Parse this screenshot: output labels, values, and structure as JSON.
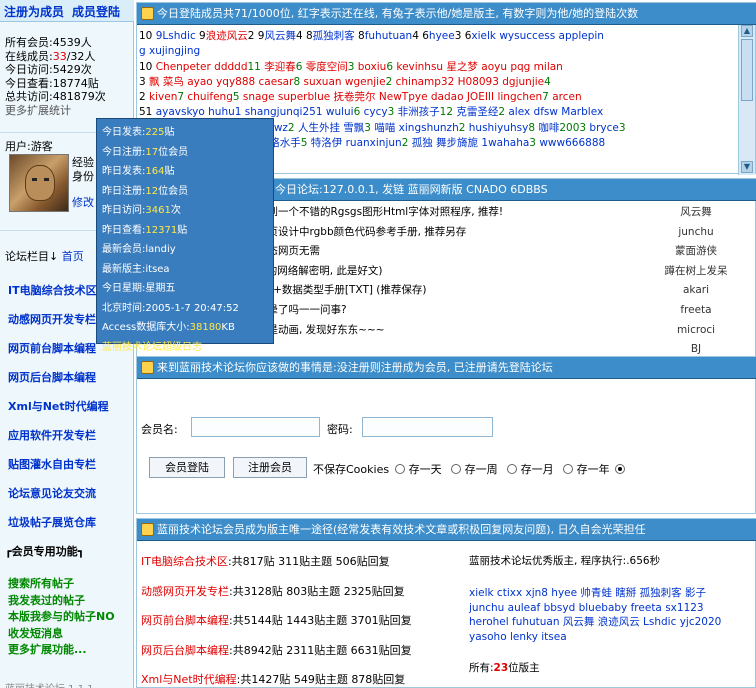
{
  "topnav": {
    "register": "注册为成员",
    "member_login": "成员登陆"
  },
  "stats": {
    "all_members_label": "所有会员:",
    "all_members": "4539人",
    "online_label": "在线成员:",
    "online_members": "33",
    "online_total": "/32人",
    "today_visits_label": "今日访问:",
    "today_visits": "5429次",
    "today_views_label": "今日查看:",
    "today_views": "18774贴",
    "total_visits_label": "总共访问:",
    "total_visits": "481879次",
    "more": "更多扩展统计"
  },
  "user": {
    "label": "用户:游客",
    "exp_label": "经验",
    "status_label": "身份",
    "modify_label": "修改"
  },
  "forum_col": {
    "label": "论坛栏目",
    "home": "首页"
  },
  "forums_sidebar": [
    "IT电脑综合技术区",
    "动感网页开发专栏",
    "网页前台脚本编程",
    "网页后台脚本编程",
    "Xml与Net时代编程",
    "应用软件开发专栏",
    "贴图灌水自由专栏",
    "论坛意见论友交流",
    "垃圾帖子展览仓库"
  ],
  "member_func": "┏会员专用功能┓",
  "member_links": [
    "搜索所有帖子",
    "我发表过的帖子",
    "本版我参与的帖子NO",
    "收发短消息",
    "更多扩展功能..."
  ],
  "sidebar_footer": "蓝丽技术论坛 1.1.1",
  "online": {
    "title": "今日登陆成员共71/1000位, 红字表示还在线, 有兔子表示他/她是版主, 有数字则为他/她的登陆次数",
    "rows": [
      [
        {
          "t": "10 ",
          "c": "k"
        },
        {
          "t": "9Lshdic",
          "c": "b"
        },
        {
          "t": " 9",
          "c": "k"
        },
        {
          "t": "浪迹风云",
          "c": "r"
        },
        {
          "t": "2 9",
          "c": "k"
        },
        {
          "t": "风云舞",
          "c": "b"
        },
        {
          "t": "4 8",
          "c": "k"
        },
        {
          "t": "孤独刺客",
          "c": "b"
        },
        {
          "t": " 8",
          "c": "k"
        },
        {
          "t": "fuhutuan",
          "c": "b"
        },
        {
          "t": "4 6",
          "c": "k"
        },
        {
          "t": "hyee",
          "c": "b"
        },
        {
          "t": "3 6",
          "c": "k"
        },
        {
          "t": "xielk wysuccess applepin",
          "c": "b"
        }
      ],
      [
        {
          "t": "g xujingjing",
          "c": "b"
        }
      ],
      [
        {
          "t": "10 ",
          "c": "k"
        },
        {
          "t": "Chenpeter ddddd",
          "c": "r"
        },
        {
          "t": "11 ",
          "c": "g"
        },
        {
          "t": "李迎春",
          "c": "r"
        },
        {
          "t": "6 ",
          "c": "g"
        },
        {
          "t": "零度空间",
          "c": "r"
        },
        {
          "t": "3 ",
          "c": "g"
        },
        {
          "t": "boxiu",
          "c": "r"
        },
        {
          "t": "6 ",
          "c": "g"
        },
        {
          "t": "kevinhsu ",
          "c": "r"
        },
        {
          "t": "星之梦 ",
          "c": "r"
        },
        {
          "t": "aoyu pqg milan",
          "c": "r"
        }
      ],
      [
        {
          "t": "3 ",
          "c": "k"
        },
        {
          "t": "飘 菜鸟 ",
          "c": "r"
        },
        {
          "t": "ayao yqy888 caesar",
          "c": "r"
        },
        {
          "t": "8 ",
          "c": "g"
        },
        {
          "t": "suxuan wgenjie",
          "c": "r"
        },
        {
          "t": "2 ",
          "c": "g"
        },
        {
          "t": "chinamp32 ",
          "c": "r"
        },
        {
          "t": "H08093 ",
          "c": "r"
        },
        {
          "t": "dgjunjie",
          "c": "r"
        },
        {
          "t": "4",
          "c": "g"
        }
      ],
      [
        {
          "t": "2 ",
          "c": "k"
        },
        {
          "t": "kiven",
          "c": "r"
        },
        {
          "t": "7 ",
          "c": "g"
        },
        {
          "t": "chuifeng",
          "c": "r"
        },
        {
          "t": "5 ",
          "c": "g"
        },
        {
          "t": "snage superblue ",
          "c": "r"
        },
        {
          "t": "抚卷莞尔 ",
          "c": "r"
        },
        {
          "t": "NewTpye dadao JOEIII lingchen",
          "c": "r"
        },
        {
          "t": "7 ",
          "c": "g"
        },
        {
          "t": "arcen",
          "c": "r"
        }
      ],
      [
        {
          "t": "51 ",
          "c": "k"
        },
        {
          "t": "ayavskyo huhu1 shangjunqi251 wului",
          "c": "b"
        },
        {
          "t": "6 ",
          "c": "g"
        },
        {
          "t": "cycy",
          "c": "b"
        },
        {
          "t": "3 ",
          "c": "g"
        },
        {
          "t": "非洲孩子",
          "c": "b"
        },
        {
          "t": "12 ",
          "c": "g"
        },
        {
          "t": "克雷圣经",
          "c": "b"
        },
        {
          "t": "2 ",
          "c": "g"
        },
        {
          "t": "alex dfsw Marblex",
          "c": "b"
        }
      ],
      [
        {
          "t": "",
          "c": "k"
        },
        {
          "t": "gingyingyc peter4102 jmlwz",
          "c": "b"
        },
        {
          "t": "2 ",
          "c": "g"
        },
        {
          "t": "人生外挂 ",
          "c": "b"
        },
        {
          "t": "雪飘",
          "c": "b"
        },
        {
          "t": "3 ",
          "c": "g"
        },
        {
          "t": "喵喵 ",
          "c": "b"
        },
        {
          "t": "xingshunzh",
          "c": "b"
        },
        {
          "t": "2 ",
          "c": "g"
        },
        {
          "t": "hushiyuhsy",
          "c": "b"
        },
        {
          "t": "8 ",
          "c": "g"
        },
        {
          "t": "咖啡",
          "c": "b"
        },
        {
          "t": "2003 ",
          "c": "g"
        },
        {
          "t": "bryce",
          "c": "b"
        },
        {
          "t": "3",
          "c": "g"
        }
      ],
      [
        {
          "t": "",
          "c": "k"
        },
        {
          "t": "ms1 ",
          "c": "b"
        },
        {
          "t": "xr ",
          "c": "b"
        },
        {
          "t": "bekilf ",
          "c": "b"
        },
        {
          "t": "arclns1",
          "c": "b"
        },
        {
          "t": "4 ",
          "c": "g"
        },
        {
          "t": "网络水手",
          "c": "b"
        },
        {
          "t": "5 ",
          "c": "g"
        },
        {
          "t": "特洛伊 ",
          "c": "b"
        },
        {
          "t": "ruanxinjun",
          "c": "b"
        },
        {
          "t": "2 ",
          "c": "g"
        },
        {
          "t": "孤独 ",
          "c": "b"
        },
        {
          "t": "舞步旖旎 ",
          "c": "b"
        },
        {
          "t": "1wahaha",
          "c": "b"
        },
        {
          "t": "3 ",
          "c": "g"
        },
        {
          "t": "www666888",
          "c": "b"
        }
      ]
    ]
  },
  "news": {
    "title": "今日论坛:127.0.0.1, 发链 蓝丽网新版 CNADO 6DBBS",
    "items": [
      "找到一个不错的Rgsgs图形Html字体对照程序, 推荐!",
      "网页设计中rgbb颜色代码参考手册, 推荐另存",
      "动态网页无需",
      "IE的网络解密明, 此是好文)",
      "C++数据类型手册[TXT] (推荐保存)",
      "你晕了吗一一问事?",
      "这是动画, 发现好东东~~~"
    ],
    "users": [
      "风云舞",
      "junchu",
      "蒙面游侠",
      "蹲在树上发呆",
      "akari",
      "freeta",
      "microci",
      "BJ"
    ]
  },
  "login": {
    "title": "来到蓝丽技术论坛你应该做的事情是:没注册则注册成为会员, 已注册请先登陆论坛",
    "user_label": "会员名:",
    "pass_label": "密码:",
    "login_btn": "会员登陆",
    "register_btn": "注册会员",
    "cookie_label": "不保存Cookies",
    "options": [
      "存一天",
      "存一周",
      "存一月",
      "存一年"
    ],
    "selected": "存一年"
  },
  "forums": {
    "title": "蓝丽技术论坛会员成为版主唯一途径(经常发表有效技术文章或积极回复网友问题), 日久自会光荣担任",
    "rows": [
      {
        "name": "IT电脑综合技术区",
        "stats": ":共817贴 311贴主题 506贴回复"
      },
      {
        "name": "动感网页开发专栏",
        "stats": ":共3128贴 803贴主题 2325贴回复"
      },
      {
        "name": "网页前台脚本编程",
        "stats": ":共5144贴 1443贴主题 3701贴回复"
      },
      {
        "name": "网页后台脚本编程",
        "stats": ":共8942贴 2311贴主题 6631贴回复"
      },
      {
        "name": "Xml与Net时代编程",
        "stats": ":共1427贴 549贴主题 878贴回复"
      }
    ],
    "right_title": "蓝丽技术论坛优秀版主, 程序执行:.656秒",
    "moderators": "xielk ctixx xjn8 hyee 帅青蛙 瞎掰 孤独刺客 影子 junchu auleaf bbsyd bluebaby freeta sx1123 herohel fuhutuan 风云舞 浪迹风云 Lshdic yjc2020 yasoho lenky itsea",
    "total_label": "所有:",
    "total_count": "23",
    "total_unit": "位版主"
  },
  "popup": {
    "today_posts_label": "今日发表:",
    "today_posts": "225",
    "today_posts_unit": "贴",
    "today_reg_label": "今日注册:",
    "today_reg": "17",
    "today_reg_unit": "位会员",
    "yest_posts_label": "昨日发表:",
    "yest_posts": "164",
    "yest_posts_unit": "贴",
    "yest_reg_label": "昨日注册:",
    "yest_reg": "12",
    "yest_reg_unit": "位会员",
    "yest_visits_label": "昨日访问:",
    "yest_visits": "3461",
    "yest_visits_unit": "次",
    "yest_views_label": "昨日查看:",
    "yest_views": "12371",
    "yest_views_unit": "贴",
    "newest_member_label": "最新会员:",
    "newest_member": "landiy",
    "newest_mod_label": "最新版主:",
    "newest_mod": "itsea",
    "weekday_label": "今日星期:",
    "weekday": "星期五",
    "beijing_label": "北京时间:",
    "beijing_time": "2005-1-7 20:47:52",
    "access_label": "Access数据库大小:",
    "access_size": "38180",
    "access_unit": "KB",
    "log_link": "蓝丽技术论坛超级日志"
  }
}
